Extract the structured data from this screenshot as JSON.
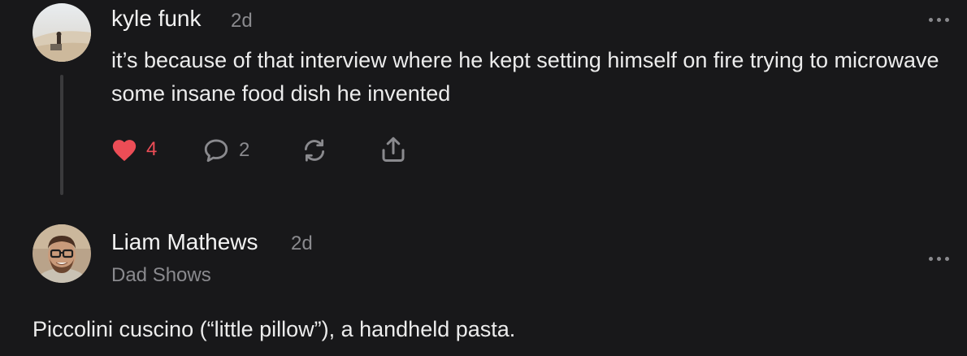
{
  "comments": [
    {
      "author": "kyle funk",
      "time": "2d",
      "text": "it’s because of that interview where he kept setting himself on fire trying to microwave some insane food dish he invented",
      "actions": {
        "likes": "4",
        "replies": "2"
      },
      "avatar_icon": "desert-figure-photo"
    },
    {
      "author": "Liam Mathews",
      "time": "2d",
      "subtitle": "Dad Shows",
      "text": "Piccolini cuscino (“little pillow”), a handheld pasta.",
      "avatar_icon": "man-with-glasses-photo"
    }
  ],
  "colors": {
    "background": "#18181a",
    "like_active": "#ec4d56",
    "muted": "#8a8a8e"
  }
}
